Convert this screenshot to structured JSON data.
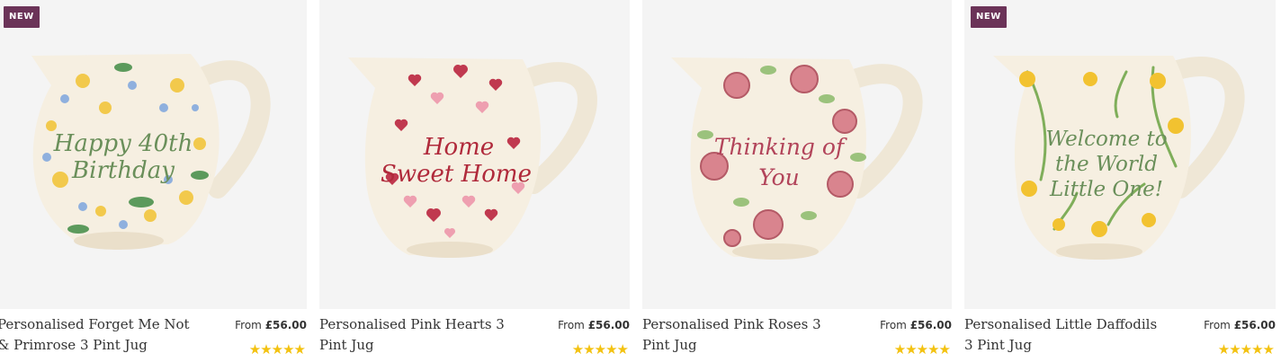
{
  "products": [
    {
      "badge": "NEW",
      "jug_text": [
        "Happy 40th",
        "Birthday"
      ],
      "title": "Personalised Forget Me Not & Primrose 3 Pint Jug",
      "price_prefix": "From",
      "price": "£56.00",
      "rating": 5,
      "stars": "★★★★★"
    },
    {
      "badge": "",
      "jug_text": [
        "Home",
        "Sweet Home"
      ],
      "title": "Personalised Pink Hearts 3 Pint Jug",
      "price_prefix": "From",
      "price": "£56.00",
      "rating": 5,
      "stars": "★★★★★"
    },
    {
      "badge": "",
      "jug_text": [
        "Thinking of",
        "You"
      ],
      "title": "Personalised Pink Roses 3 Pint Jug",
      "price_prefix": "From",
      "price": "£56.00",
      "rating": 5,
      "stars": "★★★★★"
    },
    {
      "badge": "NEW",
      "jug_text": [
        "Welcome to",
        "the World",
        "Little One!"
      ],
      "title": "Personalised Little Daffodils 3 Pint Jug",
      "price_prefix": "From",
      "price": "£56.00",
      "rating": 5,
      "stars": "★★★★★"
    }
  ],
  "colors": {
    "badge_bg": "#6b3358",
    "star": "#f3c211",
    "image_bg": "#f4f4f4",
    "jug_body": "#f6efe1"
  }
}
